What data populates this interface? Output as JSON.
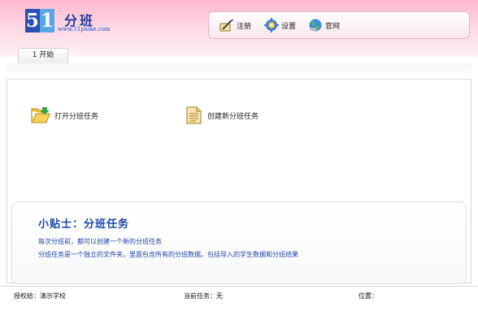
{
  "logo": {
    "d5": "5",
    "d1": "1",
    "name": "分班",
    "url": "www.51paike.com"
  },
  "toolbar": [
    {
      "label": "注册",
      "icon": "register-icon"
    },
    {
      "label": "设置",
      "icon": "gear-icon"
    },
    {
      "label": "官网",
      "icon": "globe-icon"
    }
  ],
  "tabs": [
    {
      "label": "1 开始"
    }
  ],
  "actions": [
    {
      "label": "打开分班任务",
      "icon": "folder-open-icon"
    },
    {
      "label": "创建新分班任务",
      "icon": "document-icon"
    }
  ],
  "tips": {
    "title": "小贴士：分班任务",
    "line1": "每次分班前，都可以创建一个新的分班任务",
    "line2": "分班任务是一个独立的文件夹，里面包含所有的分班数据。包括导入的学生数据和分班结果"
  },
  "status": {
    "licensed": "授权给：演示学校",
    "task": "当前任务：无",
    "location": "位置："
  }
}
